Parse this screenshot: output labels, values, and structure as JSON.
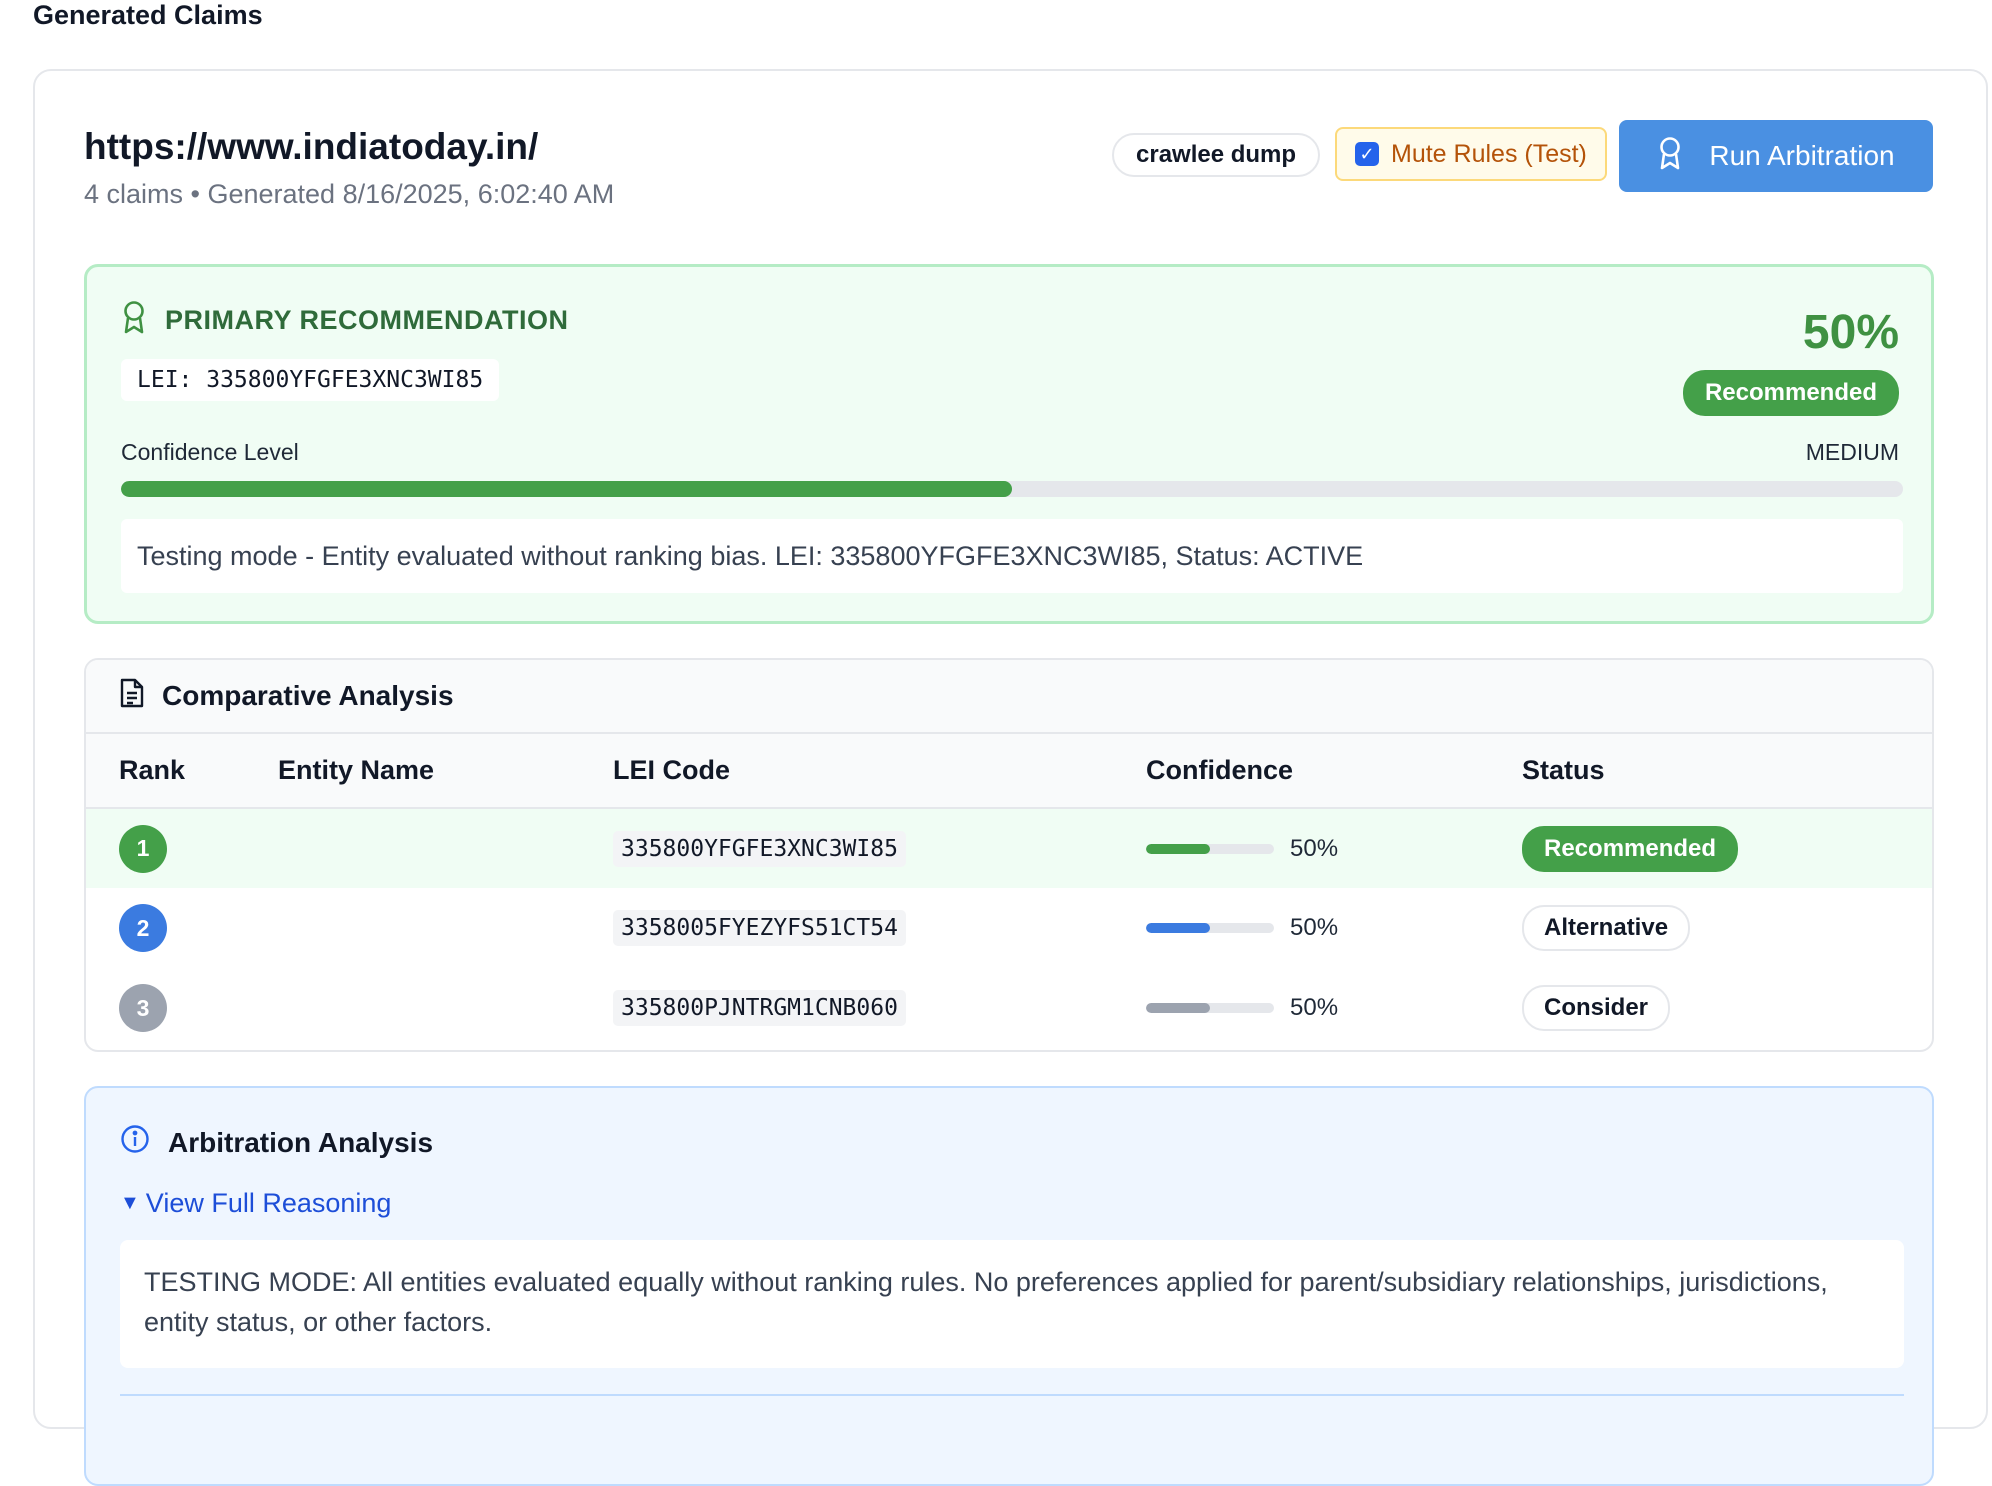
{
  "section_title": "Generated Claims",
  "header": {
    "url": "https://www.indiatoday.in/",
    "meta": "4 claims • Generated 8/16/2025, 6:02:40 AM",
    "source_pill": "crawlee dump",
    "mute_rules_label": "Mute Rules (Test)",
    "mute_rules_checked": true,
    "run_button_label": "Run Arbitration",
    "run_button_icon": "award-icon"
  },
  "primary": {
    "heading": "PRIMARY RECOMMENDATION",
    "lei": "LEI: 335800YFGFE3XNC3WI85",
    "percent": "50%",
    "badge": "Recommended",
    "confidence_label": "Confidence Level",
    "confidence_level": "MEDIUM",
    "confidence_fraction": 0.5,
    "note": "Testing mode - Entity evaluated without ranking bias. LEI: 335800YFGFE3XNC3WI85, Status: ACTIVE",
    "colors": {
      "accent": "#44a049",
      "border": "#b5ecc5",
      "background": "#f0fdf4"
    }
  },
  "comparative": {
    "title": "Comparative Analysis",
    "columns": [
      "Rank",
      "Entity Name",
      "LEI Code",
      "Confidence",
      "Status"
    ],
    "rows": [
      {
        "rank": "1",
        "entity_name": "",
        "lei": "335800YFGFE3XNC3WI85",
        "confidence": "50%",
        "confidence_fraction": 0.5,
        "status": "Recommended",
        "color": "#44a049"
      },
      {
        "rank": "2",
        "entity_name": "",
        "lei": "3358005FYEZYFS51CT54",
        "confidence": "50%",
        "confidence_fraction": 0.5,
        "status": "Alternative",
        "color": "#3b7be0"
      },
      {
        "rank": "3",
        "entity_name": "",
        "lei": "335800PJNTRGM1CNB060",
        "confidence": "50%",
        "confidence_fraction": 0.5,
        "status": "Consider",
        "color": "#9ca3af"
      }
    ]
  },
  "arbitration": {
    "title": "Arbitration Analysis",
    "toggle_label": "View Full Reasoning",
    "reasoning": "TESTING MODE: All entities evaluated equally without ranking rules. No preferences applied for parent/subsidiary relationships, jurisdictions, entity status, or other factors."
  }
}
